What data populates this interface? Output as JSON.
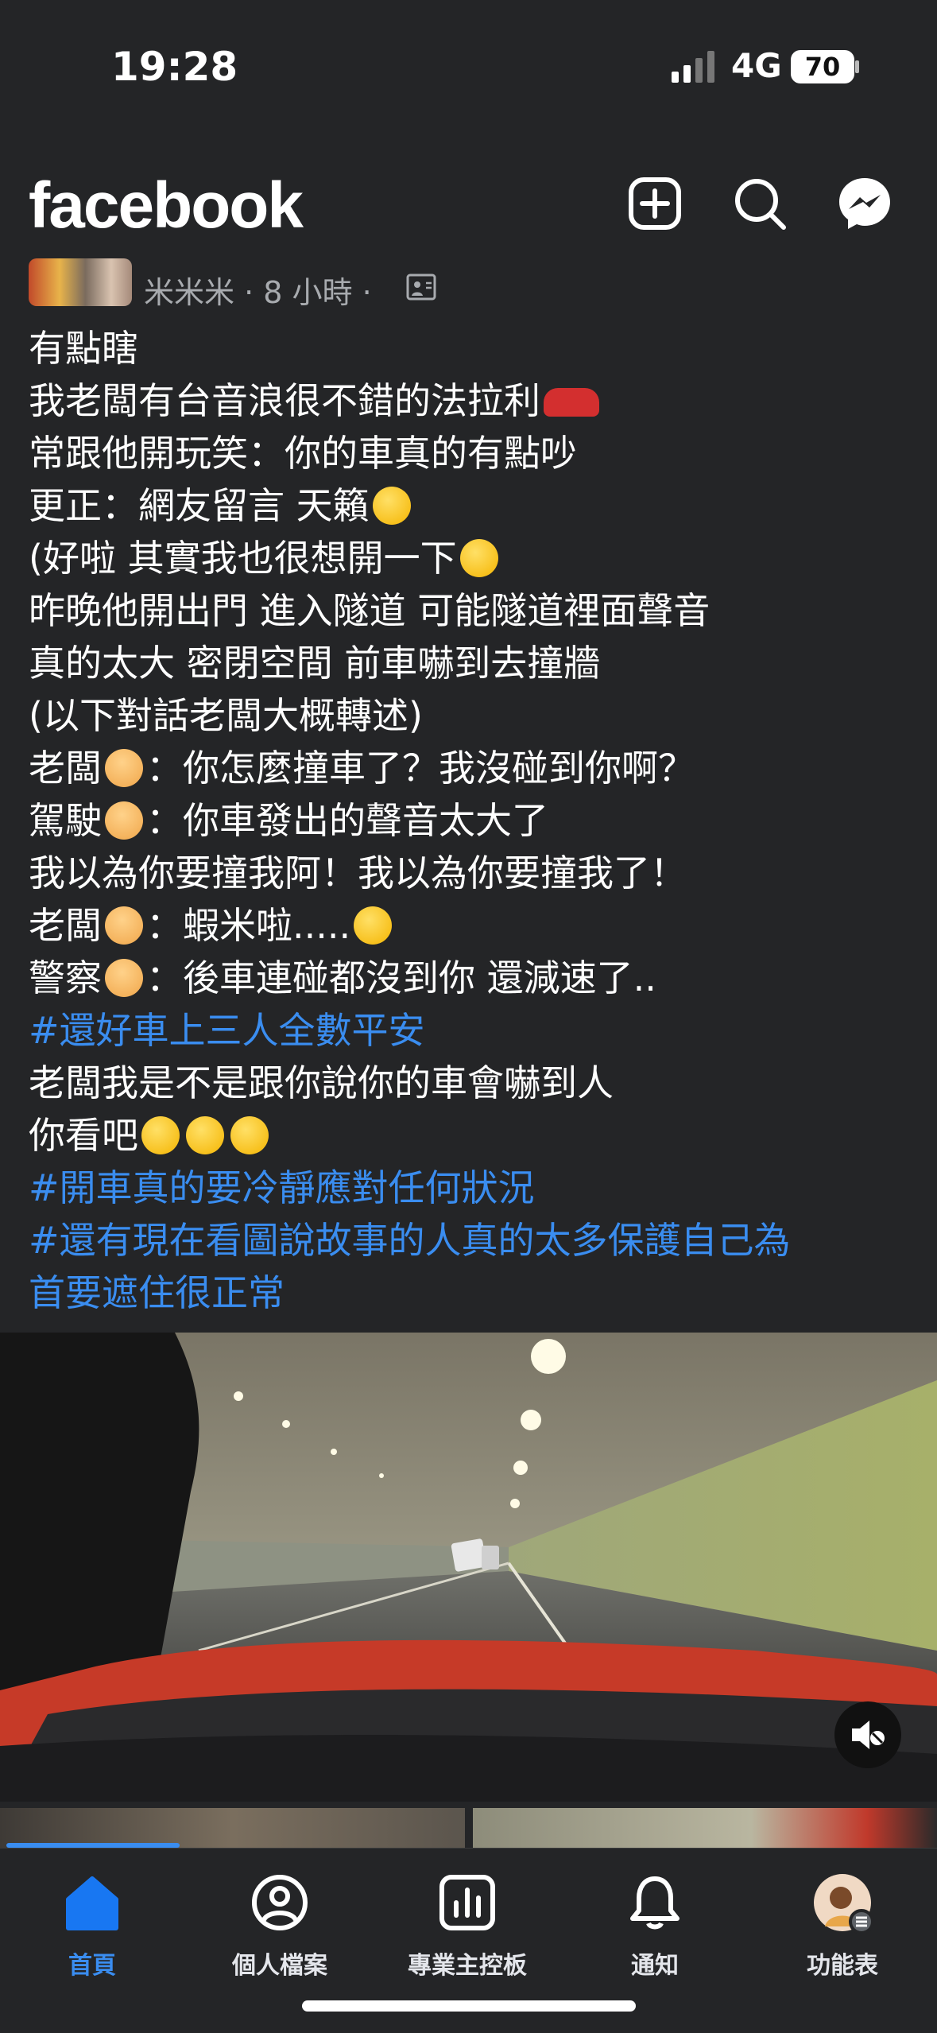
{
  "status_bar": {
    "time": "19:28",
    "network": "4G",
    "battery": "70"
  },
  "header": {
    "logo": "facebook",
    "icons": [
      "add-icon",
      "search-icon",
      "messenger-icon"
    ]
  },
  "post": {
    "author": "米米米",
    "meta": "· 8 小時 ·",
    "lines": [
      "有點瞎",
      "我老闆有台音浪很不錯的法拉利",
      "常跟他開玩笑：你的車真的有點吵",
      "更正：網友留言 天籟",
      "(好啦 其實我也很想開一下",
      "昨晚他開出門 進入隧道 可能隧道裡面聲音",
      "真的太大 密閉空間 前車嚇到去撞牆",
      "(以下對話老闆大概轉述)",
      "老闆",
      "：你怎麼撞車了？我沒碰到你啊？",
      "駕駛",
      "：你車發出的聲音太大了",
      "我以為你要撞我阿！我以為你要撞我了！",
      "老闆",
      "：蝦米啦.....",
      "警察",
      "：後車連碰都沒到你 還減速了..",
      "#還好車上三人全數平安",
      "老闆我是不是跟你說你的車會嚇到人",
      "你看吧",
      "#開車真的要冷靜應對任何狀況",
      "#還有現在看圖說故事的人真的太多保護自己為",
      "首要遮住很正常"
    ]
  },
  "video": {
    "mute_icon": "muted-speaker-icon"
  },
  "bottom_nav": {
    "items": [
      {
        "label": "首頁",
        "icon": "home-icon"
      },
      {
        "label": "個人檔案",
        "icon": "profile-icon"
      },
      {
        "label": "專業主控板",
        "icon": "dashboard-icon"
      },
      {
        "label": "通知",
        "icon": "bell-icon"
      },
      {
        "label": "功能表",
        "icon": "menu-avatar-icon"
      }
    ]
  },
  "colors": {
    "background": "#242527",
    "accent": "#3a8df0",
    "text": "#ffffff",
    "meta": "#a8abaf"
  }
}
